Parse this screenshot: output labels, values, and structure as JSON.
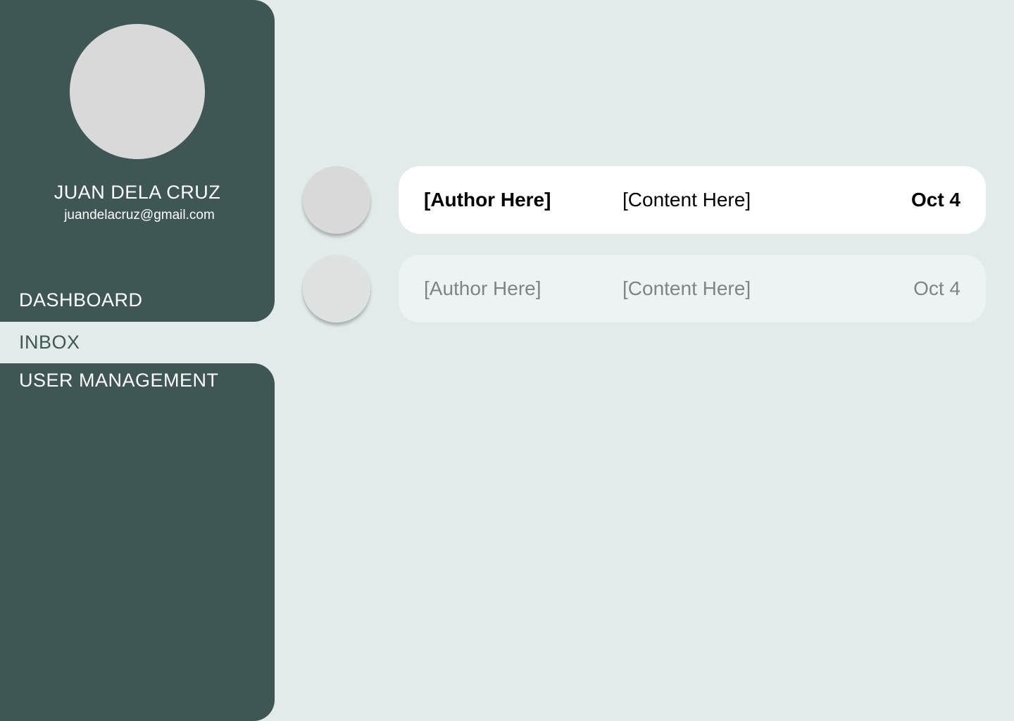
{
  "profile": {
    "name": "JUAN DELA CRUZ",
    "email": "juandelacruz@gmail.com"
  },
  "nav": {
    "items": [
      {
        "label": "DASHBOARD",
        "active": false
      },
      {
        "label": "INBOX",
        "active": true
      },
      {
        "label": "USER MANAGEMENT",
        "active": false
      }
    ]
  },
  "messages": [
    {
      "author": "[Author Here]",
      "content": "[Content Here]",
      "date": "Oct 4",
      "unread": true
    },
    {
      "author": "[Author Here]",
      "content": "[Content Here]",
      "date": "Oct 4",
      "unread": false
    }
  ],
  "colors": {
    "sidebar": "#3E5654",
    "background": "#E2EBEA",
    "card_unread": "#FFFFFF",
    "card_read": "#EDF3F3",
    "avatar_placeholder": "#D9D9D9",
    "muted_text": "#7E8584"
  }
}
